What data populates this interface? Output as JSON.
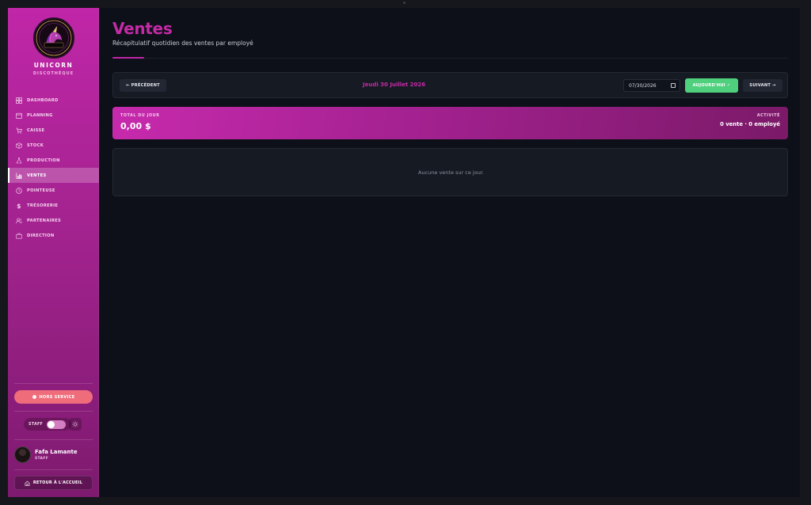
{
  "brand": {
    "name": "UNICORN",
    "subtitle": "DISCOTHÈQUE",
    "logo_text": "UNICORN"
  },
  "sidebar": {
    "items": [
      {
        "label": "DASHBOARD",
        "icon": "grid-icon",
        "active": false
      },
      {
        "label": "PLANNING",
        "icon": "calendar-icon",
        "active": false
      },
      {
        "label": "CAISSE",
        "icon": "cart-icon",
        "active": false
      },
      {
        "label": "STOCK",
        "icon": "box-icon",
        "active": false
      },
      {
        "label": "PRODUCTION",
        "icon": "flask-icon",
        "active": false
      },
      {
        "label": "VENTES",
        "icon": "bar-chart-icon",
        "active": true
      },
      {
        "label": "POINTEUSE",
        "icon": "clock-icon",
        "active": false
      },
      {
        "label": "TRÉSORERIE",
        "icon": "dollar-icon",
        "active": false
      },
      {
        "label": "PARTENAIRES",
        "icon": "users-icon",
        "active": false
      },
      {
        "label": "DIRECTION",
        "icon": "briefcase-icon",
        "active": false
      }
    ],
    "status_button": "HORS SERVICE",
    "staff_toggle_label": "STAFF",
    "user": {
      "name": "Fafa Lamante",
      "role": "STAFF"
    },
    "back_button": "RETOUR À L'ACCUEIL"
  },
  "header": {
    "title": "Ventes",
    "subtitle": "Récapitulatif quotidien des ventes par employé"
  },
  "toolbar": {
    "prev_label": "← PRÉCÉDENT",
    "date_label": "Jeudi 30 Juillet 2026",
    "date_value": "07/30/2026",
    "today_label": "AUJOURD'HUI ✓",
    "next_label": "SUIVANT →"
  },
  "summary": {
    "total_label": "TOTAL DU JOUR",
    "total_value": "0,00 $",
    "activity_label": "ACTIVITÉ",
    "activity_value": "0 vente · 0 employé"
  },
  "empty_state": {
    "message": "Aucune vente sur ce jour."
  },
  "colors": {
    "accent": "#c026a8",
    "success": "#4fd07d",
    "danger": "#ef6d7a",
    "background": "#0d1018",
    "panel": "#161a23"
  }
}
